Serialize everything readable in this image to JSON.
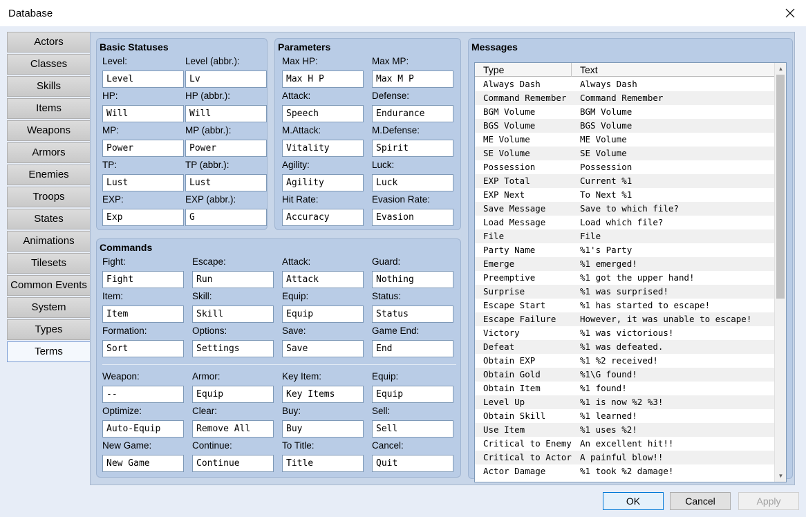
{
  "window": {
    "title": "Database"
  },
  "sidebar": {
    "items": [
      {
        "label": "Actors"
      },
      {
        "label": "Classes"
      },
      {
        "label": "Skills"
      },
      {
        "label": "Items"
      },
      {
        "label": "Weapons"
      },
      {
        "label": "Armors"
      },
      {
        "label": "Enemies"
      },
      {
        "label": "Troops"
      },
      {
        "label": "States"
      },
      {
        "label": "Animations"
      },
      {
        "label": "Tilesets"
      },
      {
        "label": "Common Events"
      },
      {
        "label": "System"
      },
      {
        "label": "Types"
      },
      {
        "label": "Terms"
      }
    ]
  },
  "basic": {
    "title": "Basic Statuses",
    "fields": [
      {
        "label": "Level:",
        "value": "Level"
      },
      {
        "label": "Level (abbr.):",
        "value": "Lv"
      },
      {
        "label": "HP:",
        "value": "Will"
      },
      {
        "label": "HP (abbr.):",
        "value": "Will"
      },
      {
        "label": "MP:",
        "value": "Power"
      },
      {
        "label": "MP (abbr.):",
        "value": "Power"
      },
      {
        "label": "TP:",
        "value": "Lust"
      },
      {
        "label": "TP (abbr.):",
        "value": "Lust"
      },
      {
        "label": "EXP:",
        "value": "Exp"
      },
      {
        "label": "EXP (abbr.):",
        "value": "G"
      }
    ]
  },
  "params": {
    "title": "Parameters",
    "fields": [
      {
        "label": "Max HP:",
        "value": "Max H P"
      },
      {
        "label": "Max MP:",
        "value": "Max M P"
      },
      {
        "label": "Attack:",
        "value": "Speech"
      },
      {
        "label": "Defense:",
        "value": "Endurance"
      },
      {
        "label": "M.Attack:",
        "value": "Vitality"
      },
      {
        "label": "M.Defense:",
        "value": "Spirit"
      },
      {
        "label": "Agility:",
        "value": "Agility"
      },
      {
        "label": "Luck:",
        "value": "Luck"
      },
      {
        "label": "Hit Rate:",
        "value": "Accuracy"
      },
      {
        "label": "Evasion Rate:",
        "value": "Evasion"
      }
    ]
  },
  "commands": {
    "title": "Commands",
    "fields": [
      {
        "label": "Fight:",
        "value": "Fight"
      },
      {
        "label": "Escape:",
        "value": "Run"
      },
      {
        "label": "Attack:",
        "value": "Attack"
      },
      {
        "label": "Guard:",
        "value": "Nothing"
      },
      {
        "label": "Item:",
        "value": "Item"
      },
      {
        "label": "Skill:",
        "value": "Skill"
      },
      {
        "label": "Equip:",
        "value": "Equip"
      },
      {
        "label": "Status:",
        "value": "Status"
      },
      {
        "label": "Formation:",
        "value": "Sort"
      },
      {
        "label": "Options:",
        "value": "Settings"
      },
      {
        "label": "Save:",
        "value": "Save"
      },
      {
        "label": "Game End:",
        "value": "End"
      },
      {
        "label": "Weapon:",
        "value": "--"
      },
      {
        "label": "Armor:",
        "value": "Equip"
      },
      {
        "label": "Key Item:",
        "value": "Key Items"
      },
      {
        "label": "Equip:",
        "value": "Equip"
      },
      {
        "label": "Optimize:",
        "value": "Auto-Equip"
      },
      {
        "label": "Clear:",
        "value": "Remove All"
      },
      {
        "label": "Buy:",
        "value": "Buy"
      },
      {
        "label": "Sell:",
        "value": "Sell"
      },
      {
        "label": "New Game:",
        "value": "New Game"
      },
      {
        "label": "Continue:",
        "value": "Continue"
      },
      {
        "label": "To Title:",
        "value": "Title"
      },
      {
        "label": "Cancel:",
        "value": "Quit"
      }
    ]
  },
  "messages": {
    "title": "Messages",
    "col_type": "Type",
    "col_text": "Text",
    "rows": [
      [
        "Always Dash",
        "Always Dash"
      ],
      [
        "Command Remember",
        "Command Remember"
      ],
      [
        "BGM Volume",
        "BGM Volume"
      ],
      [
        "BGS Volume",
        "BGS Volume"
      ],
      [
        "ME Volume",
        "ME Volume"
      ],
      [
        "SE Volume",
        "SE Volume"
      ],
      [
        "Possession",
        "Possession"
      ],
      [
        "EXP Total",
        "Current %1"
      ],
      [
        "EXP Next",
        "To Next %1"
      ],
      [
        "Save Message",
        "Save to which file?"
      ],
      [
        "Load Message",
        "Load which file?"
      ],
      [
        "File",
        "File"
      ],
      [
        "Party Name",
        "%1's Party"
      ],
      [
        "Emerge",
        "%1 emerged!"
      ],
      [
        "Preemptive",
        "%1 got the upper hand!"
      ],
      [
        "Surprise",
        "%1 was surprised!"
      ],
      [
        "Escape Start",
        "%1 has started to escape!"
      ],
      [
        "Escape Failure",
        "However, it was unable to escape!"
      ],
      [
        "Victory",
        "%1 was victorious!"
      ],
      [
        "Defeat",
        "%1 was defeated."
      ],
      [
        "Obtain EXP",
        "%1 %2 received!"
      ],
      [
        "Obtain Gold",
        "%1\\G found!"
      ],
      [
        "Obtain Item",
        "%1 found!"
      ],
      [
        "Level Up",
        "%1 is now %2 %3!"
      ],
      [
        "Obtain Skill",
        "%1 learned!"
      ],
      [
        "Use Item",
        "%1 uses %2!"
      ],
      [
        "Critical to Enemy",
        "An excellent hit!!"
      ],
      [
        "Critical to Actor",
        "A painful blow!!"
      ],
      [
        "Actor Damage",
        "%1 took %2 damage!"
      ]
    ]
  },
  "buttons": {
    "ok": "OK",
    "cancel": "Cancel",
    "apply": "Apply"
  }
}
